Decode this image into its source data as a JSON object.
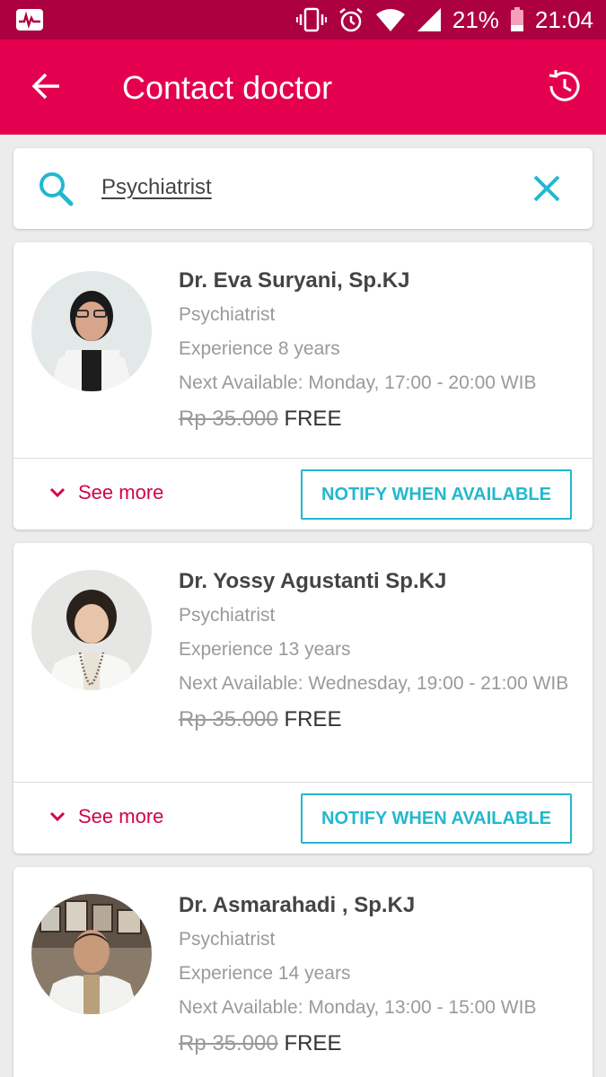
{
  "status_bar": {
    "app_icon": "pulse-app-icon",
    "battery": "21%",
    "time": "21:04",
    "icons": [
      "vibrate-icon",
      "alarm-icon",
      "wifi-icon",
      "signal-icon",
      "battery-icon"
    ]
  },
  "app_bar": {
    "title": "Contact doctor",
    "back_icon": "arrow-back-icon",
    "history_icon": "history-icon",
    "color": "#e5004f"
  },
  "search": {
    "value": "Psychiatrist",
    "search_icon": "search-icon",
    "clear_icon": "close-icon"
  },
  "doctors": [
    {
      "name": "Dr. Eva  Suryani, Sp.KJ",
      "specialty": "Psychiatrist",
      "experience": "Experience 8 years",
      "next_available": "Next Available: Monday, 17:00 - 20:00 WIB",
      "old_price": "Rp 35.000",
      "price": "FREE",
      "see_more": "See more",
      "notify": "NOTIFY WHEN AVAILABLE"
    },
    {
      "name": "Dr. Yossy Agustanti Sp.KJ",
      "specialty": "Psychiatrist",
      "experience": "Experience 13 years",
      "next_available": "Next Available: Wednesday, 19:00 - 21:00 WIB",
      "old_price": "Rp 35.000",
      "price": "FREE",
      "see_more": "See more",
      "notify": "NOTIFY WHEN AVAILABLE"
    },
    {
      "name": "Dr. Asmarahadi , Sp.KJ",
      "specialty": "Psychiatrist",
      "experience": "Experience 14 years",
      "next_available": "Next Available: Monday, 13:00 - 15:00 WIB",
      "old_price": "Rp 35.000",
      "price": "FREE"
    }
  ],
  "colors": {
    "accent": "#e5004f",
    "status_bar": "#ad0040",
    "teal": "#22b8cf",
    "pink_text": "#d4004f"
  }
}
